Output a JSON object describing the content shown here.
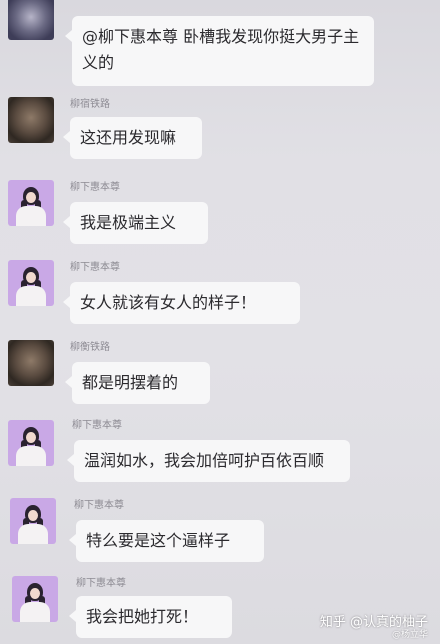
{
  "messages": [
    {
      "sender": "",
      "text": "@柳下惠本尊  卧槽我发现你挺大男子主义的",
      "avatar": "blurred-avatar-icon"
    },
    {
      "sender": "柳宿铁路",
      "text": "这还用发现嘛",
      "avatar": "dark-avatar-icon"
    },
    {
      "sender": "柳下惠本尊",
      "text": "我是极端主义",
      "avatar": "lilac-avatar-icon"
    },
    {
      "sender": "柳下惠本尊",
      "text": "女人就该有女人的样子！",
      "avatar": "lilac-avatar-icon"
    },
    {
      "sender": "柳衡铁路",
      "text": "都是明摆着的",
      "avatar": "dark-avatar-icon"
    },
    {
      "sender": "柳下惠本尊",
      "text": "温润如水，我会加倍呵护百依百顺",
      "avatar": "lilac-avatar-icon"
    },
    {
      "sender": "柳下惠本尊",
      "text": "特么要是这个逼样子",
      "avatar": "lilac-avatar-icon"
    },
    {
      "sender": "柳下惠本尊",
      "text": "我会把她打死！",
      "avatar": "lilac-avatar-icon"
    }
  ],
  "watermark": {
    "main": "知乎 @认真的柚子",
    "sub": "@杨立华"
  },
  "colors": {
    "background": "#e1e0e5",
    "bubble": "#f7f7f8",
    "avatar_lilac": "#c9a8e6"
  }
}
